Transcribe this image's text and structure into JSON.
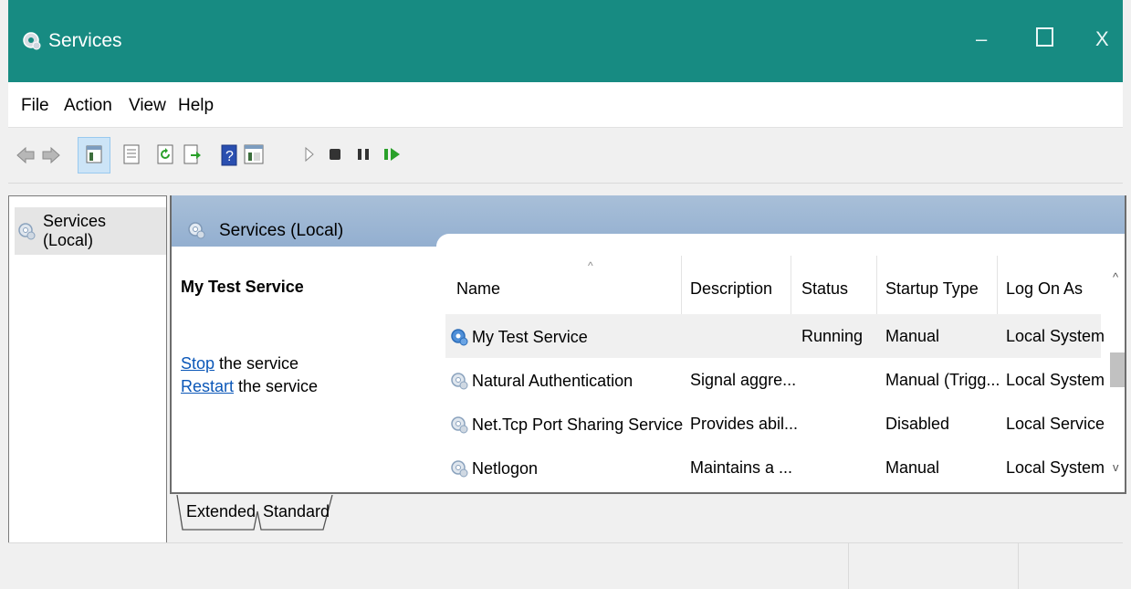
{
  "window": {
    "title": "Services",
    "controls": {
      "minimize": "–",
      "close": "X"
    }
  },
  "menu": [
    "File",
    "Action",
    "View",
    "Help"
  ],
  "tree": {
    "root": "Services (Local)"
  },
  "main": {
    "header_title": "Services (Local)",
    "selected_service": "My Test Service",
    "actions": [
      {
        "link": "Stop",
        "text": " the service"
      },
      {
        "link": "Restart",
        "text": " the service"
      }
    ],
    "sort_indicator": "^",
    "columns": [
      "Name",
      "Description",
      "Status",
      "Startup Type",
      "Log On As"
    ],
    "rows": [
      {
        "name": "My Test Service",
        "description": "",
        "status": "Running",
        "startup": "Manual",
        "logon": "Local System",
        "selected": true
      },
      {
        "name": "Natural Authentication",
        "description": "Signal aggre...",
        "status": "",
        "startup": "Manual (Trigg...",
        "logon": "Local System"
      },
      {
        "name": "Net.Tcp Port Sharing Service",
        "description": "Provides abil...",
        "status": "",
        "startup": "Disabled",
        "logon": "Local Service"
      },
      {
        "name": "Netlogon",
        "description": "Maintains a ...",
        "status": "",
        "startup": "Manual",
        "logon": "Local System"
      }
    ],
    "scroll": {
      "up": "^",
      "down": "v"
    }
  },
  "tabs": [
    "Extended",
    "Standard"
  ],
  "colors": {
    "titlebar": "#178b82",
    "header_band": "#9fb9d6",
    "link": "#0b57b8"
  },
  "icons": [
    "services-gear-icon",
    "back-arrow-icon",
    "forward-arrow-icon",
    "show-hide-tree-icon",
    "properties-icon",
    "refresh-icon",
    "export-list-icon",
    "help-icon",
    "view-icon",
    "start-icon",
    "stop-icon",
    "pause-icon",
    "resume-icon"
  ]
}
